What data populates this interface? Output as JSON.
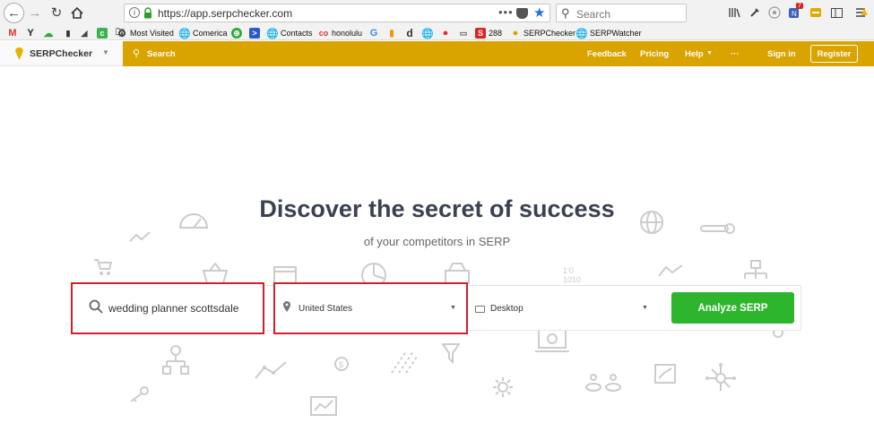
{
  "browser": {
    "url": "https://app.serpchecker.com",
    "search_placeholder": "Search",
    "notification_badge": "7"
  },
  "bookmarks": [
    {
      "icon": "gmail-icon",
      "label": ""
    },
    {
      "icon": "yahoo-icon",
      "label": ""
    },
    {
      "icon": "cloud-icon",
      "label": ""
    },
    {
      "icon": "evernote-icon",
      "label": ""
    },
    {
      "icon": "tag-icon",
      "label": ""
    },
    {
      "icon": "green-app-icon",
      "label": ""
    },
    {
      "icon": "folder-icon",
      "label": ""
    },
    {
      "icon": "gear-icon",
      "label": "Most Visited"
    },
    {
      "icon": "globe-icon",
      "label": "Comerica"
    },
    {
      "icon": "green-circle-icon",
      "label": ""
    },
    {
      "icon": "blue-arrow-icon",
      "label": ""
    },
    {
      "icon": "globe-icon",
      "label": "Contacts"
    },
    {
      "icon": "co-icon",
      "label": "honolulu"
    },
    {
      "icon": "google-icon",
      "label": ""
    },
    {
      "icon": "analytics-icon",
      "label": ""
    },
    {
      "icon": "d-icon",
      "label": ""
    },
    {
      "icon": "globe-icon",
      "label": ""
    },
    {
      "icon": "red-person-icon",
      "label": ""
    },
    {
      "icon": "folder-icon",
      "label": ""
    },
    {
      "icon": "s-icon",
      "label": "288"
    },
    {
      "icon": "serpchecker-icon",
      "label": "SERPChecker"
    },
    {
      "icon": "globe-icon",
      "label": "SERPWatcher"
    }
  ],
  "header": {
    "brand": "SERPChecker",
    "search_label": "Search",
    "links": [
      "Feedback",
      "Pricing",
      "Help"
    ],
    "more": "···",
    "sign_in": "Sign in",
    "register": "Register"
  },
  "hero": {
    "title": "Discover the secret of success",
    "subtitle": "of your competitors in SERP"
  },
  "form": {
    "keyword_value": "wedding planner scottsdale",
    "location_value": "United States",
    "device_value": "Desktop",
    "submit_label": "Analyze SERP"
  },
  "colors": {
    "header_bg": "#d9a400",
    "submit_bg": "#2db52d",
    "highlight_border": "#d0202a",
    "title_text": "#3a4150"
  }
}
